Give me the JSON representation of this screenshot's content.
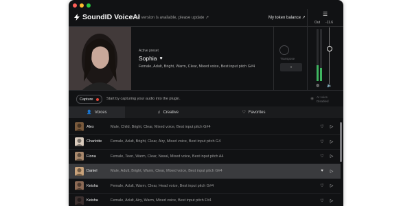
{
  "app": {
    "name": "SoundID VoiceAI",
    "update_text": "New version is available, please update ↗",
    "token_balance": "My token balance ↗"
  },
  "preset": {
    "label": "Active preset",
    "name": "Sophia",
    "tags": "Female, Adult, Bright, Warm, Clear, Mixed voice, Best input pitch  G#4"
  },
  "transpose": {
    "label": "Transpose"
  },
  "output": {
    "label": "Out",
    "value": "-11.6",
    "meter_levels": [
      0.3,
      0.25
    ]
  },
  "capture": {
    "button": "Capture",
    "hint": "Start by capturing your audio into the plugin."
  },
  "ai_status": {
    "line1": "AI voice",
    "line2": "Disabled"
  },
  "tabs": [
    {
      "label": "Voices"
    },
    {
      "label": "Creative"
    },
    {
      "label": "Favorites"
    }
  ],
  "voices": [
    {
      "name": "Alex",
      "tags": "Male, Child, Bright, Clear, Mixed voice, Best input pitch  G#4"
    },
    {
      "name": "Charlotte",
      "tags": "Female, Adult, Bright, Clear, Airy, Mixed voice, Best input pitch  G4"
    },
    {
      "name": "Fiona",
      "tags": "Female, Teen, Warm, Clear, Nasal, Mixed voice, Best input pitch  A4"
    },
    {
      "name": "Daniel",
      "tags": "Male, Adult, Bright, Warm, Clear, Mixed voice, Best input pitch  G#4"
    },
    {
      "name": "Keisha",
      "tags": "Female, Adult, Warm, Clear, Head voice, Best input pitch  G#4"
    },
    {
      "name": "Keisha",
      "tags": "Female, Adult, Airy, Warm, Mixed voice, Best input pitch  F#4"
    }
  ],
  "colors": {
    "accent": "#3fb560",
    "record": "#e5483a",
    "selected_row": "#3a3b3e"
  }
}
